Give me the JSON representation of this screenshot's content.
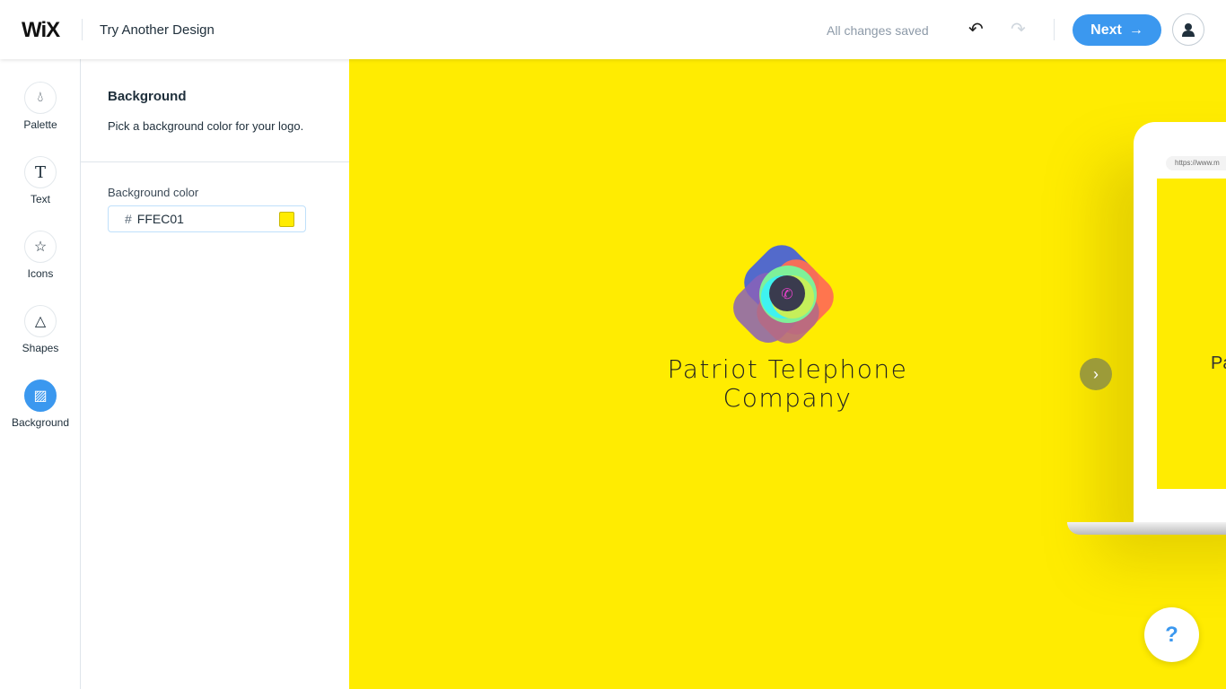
{
  "header": {
    "brand": "WiX",
    "title": "Try Another Design",
    "status": "All changes saved",
    "next_label": "Next",
    "undo_icon": "undo-icon",
    "redo_icon": "redo-icon"
  },
  "rail": {
    "items": [
      {
        "label": "Palette",
        "icon": "drop-icon"
      },
      {
        "label": "Text",
        "icon": "text-icon"
      },
      {
        "label": "Icons",
        "icon": "star-icon"
      },
      {
        "label": "Shapes",
        "icon": "shapes-icon"
      },
      {
        "label": "Background",
        "icon": "background-icon",
        "active": true
      }
    ]
  },
  "panel": {
    "heading": "Background",
    "description": "Pick a background color for your logo.",
    "field_label": "Background color",
    "hash": "#",
    "color_value": "FFEC01"
  },
  "canvas": {
    "background": "#FFEC01",
    "logo_line1": "Patriot Telephone",
    "logo_line2": "Company",
    "preview_url": "https://www.m",
    "preview_text": "Pa",
    "help_label": "?"
  },
  "colors": {
    "accent": "#3b98ef"
  }
}
